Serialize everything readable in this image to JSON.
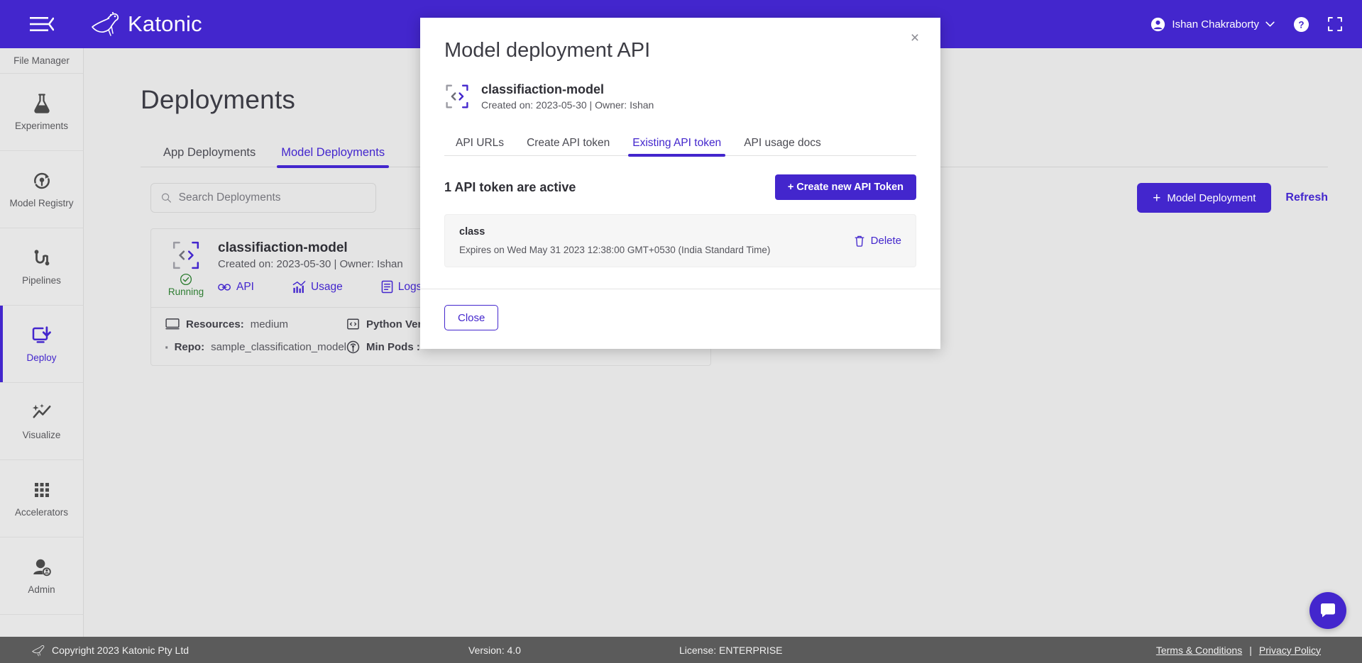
{
  "topbar": {
    "menu_icon": "hamburger-collapse-icon",
    "brand": "Katonic",
    "user_name": "Ishan Chakraborty",
    "help_icon": "help-circle-icon",
    "fullscreen_icon": "fullscreen-icon"
  },
  "sidebar": {
    "items": [
      {
        "label": "File Manager",
        "icon": "folder-icon",
        "active": false
      },
      {
        "label": "Experiments",
        "icon": "flask-icon",
        "active": false
      },
      {
        "label": "Model Registry",
        "icon": "model-registry-icon",
        "active": false
      },
      {
        "label": "Pipelines",
        "icon": "pipelines-icon",
        "active": false
      },
      {
        "label": "Deploy",
        "icon": "deploy-icon",
        "active": true
      },
      {
        "label": "Visualize",
        "icon": "visualize-sparkline-icon",
        "active": false
      },
      {
        "label": "Accelerators",
        "icon": "grid-dots-icon",
        "active": false
      },
      {
        "label": "Admin",
        "icon": "admin-user-icon",
        "active": false
      }
    ]
  },
  "page": {
    "title": "Deployments",
    "tabs": [
      {
        "label": "App Deployments",
        "active": false
      },
      {
        "label": "Model Deployments",
        "active": true
      }
    ],
    "search_placeholder": "Search Deployments",
    "search_value": "",
    "add_button": "Model Deployment",
    "add_button_plus": "+",
    "refresh_link": "Refresh"
  },
  "deployment_card": {
    "name": "classifiaction-model",
    "meta": "Created on: 2023-05-30 | Owner: Ishan",
    "status": "Running",
    "actions": [
      {
        "label": "API",
        "icon": "link-icon"
      },
      {
        "label": "Usage",
        "icon": "chart-bars-icon"
      },
      {
        "label": "Logs",
        "icon": "document-lines-icon"
      }
    ],
    "facts": [
      {
        "label": "Resources:",
        "value": "medium",
        "icon": "monitor-icon"
      },
      {
        "label": "Python Ver",
        "value": "",
        "icon": "code-brackets-icon"
      },
      {
        "label": "Repo:",
        "value": "sample_classification_model",
        "icon": "server-stack-icon"
      },
      {
        "label": "Min Pods :",
        "value": "",
        "icon": "broadcast-icon"
      }
    ]
  },
  "modal": {
    "title": "Model deployment API",
    "close_x": "×",
    "model": {
      "name": "classifiaction-model",
      "meta": "Created on: 2023-05-30 | Owner: Ishan",
      "icon": "code-brackets-frame-icon"
    },
    "tabs": [
      {
        "label": "API URLs",
        "active": false
      },
      {
        "label": "Create API token",
        "active": false
      },
      {
        "label": "Existing API token",
        "active": true
      },
      {
        "label": "API usage docs",
        "active": false
      }
    ],
    "tokens_count_text": "1 API token are active",
    "create_button": "+ Create new API Token",
    "tokens": [
      {
        "name": "class",
        "expires": "Expires on Wed May 31 2023 12:38:00 GMT+0530 (India Standard Time)",
        "delete_label": "Delete",
        "delete_icon": "trash-icon"
      }
    ],
    "close_button": "Close"
  },
  "footer": {
    "copyright": "Copyright 2023 Katonic Pty Ltd",
    "version": "Version: 4.0",
    "license": "License: ENTERPRISE",
    "terms": "Terms & Conditions",
    "separator": "|",
    "privacy": "Privacy Policy"
  },
  "chat": {
    "icon": "chat-bubble-icon"
  },
  "colors": {
    "brand_purple": "#4326cd",
    "sidebar_bg": "#e6e6e6",
    "page_bg": "#e4e4e4",
    "footer_bg": "#5b5b5b",
    "status_green": "#2e7d32"
  }
}
